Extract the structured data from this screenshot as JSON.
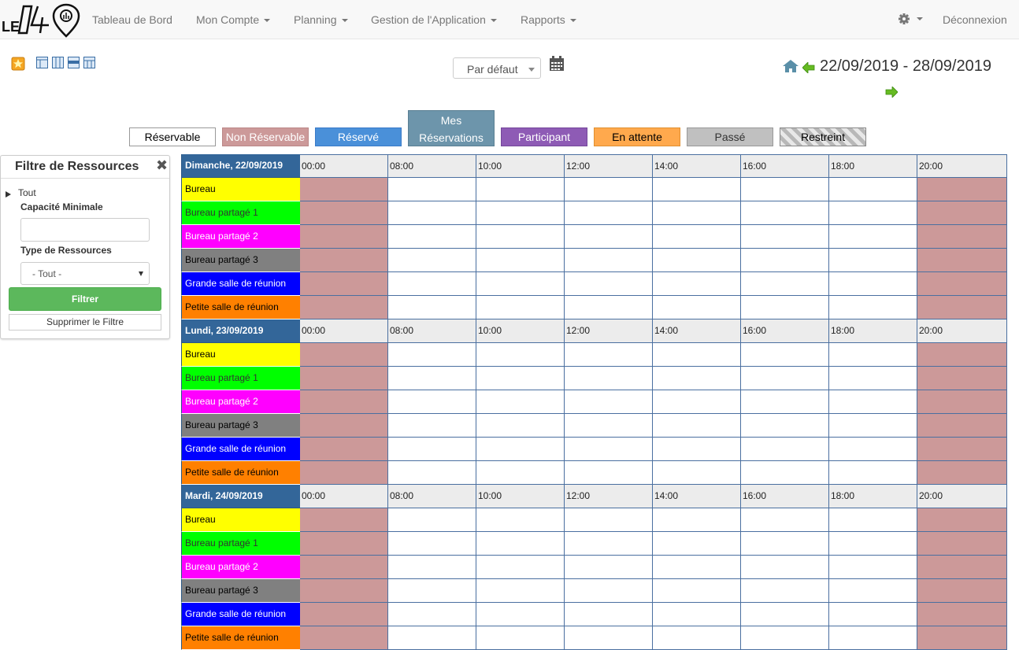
{
  "nav": {
    "logo_text": "LE 140",
    "items": [
      {
        "label": "Tableau de Bord",
        "dropdown": false
      },
      {
        "label": "Mon Compte",
        "dropdown": true
      },
      {
        "label": "Planning",
        "dropdown": true
      },
      {
        "label": "Gestion de l'Application",
        "dropdown": true
      },
      {
        "label": "Rapports",
        "dropdown": true
      }
    ],
    "settings_icon": "gear-icon",
    "logout": "Déconnexion"
  },
  "toolbar": {
    "layout_select_value": "Par défaut",
    "date_range": "22/09/2019 - 28/09/2019"
  },
  "legend": [
    {
      "label": "Réservable",
      "bg": "#ffffff",
      "fg": "#000000"
    },
    {
      "label": "Non Réservable",
      "bg": "#cc9999",
      "fg": "#ffffff"
    },
    {
      "label": "Réservé",
      "bg": "#4a90d9",
      "fg": "#ffffff"
    },
    {
      "label": "Mes Réservations",
      "bg": "#6d95ab",
      "fg": "#ffffff"
    },
    {
      "label": "Participant",
      "bg": "#8e5bb5",
      "fg": "#ffffff"
    },
    {
      "label": "En attente",
      "bg": "#ffa94d",
      "fg": "#000000"
    },
    {
      "label": "Passé",
      "bg": "#c0c0c0",
      "fg": "#333333"
    },
    {
      "label": "Restreint",
      "bg": "#d0d0d0",
      "fg": "#000000"
    }
  ],
  "filter": {
    "title": "Filtre de Ressources",
    "tree_root": "Tout",
    "min_capacity_label": "Capacité Minimale",
    "min_capacity_value": "",
    "resource_type_label": "Type de Ressources",
    "resource_type_value": "- Tout -",
    "filter_button": "Filtrer",
    "clear_button": "Supprimer le Filtre"
  },
  "schedule": {
    "times": [
      "00:00",
      "08:00",
      "10:00",
      "12:00",
      "14:00",
      "16:00",
      "18:00",
      "20:00"
    ],
    "resources": [
      {
        "name": "Bureau",
        "bg": "#ffff00",
        "fg": "#000000"
      },
      {
        "name": "Bureau partagé 1",
        "bg": "#00ff00",
        "fg": "#333333"
      },
      {
        "name": "Bureau partagé 2",
        "bg": "#ff00ff",
        "fg": "#ffffff"
      },
      {
        "name": "Bureau partagé 3",
        "bg": "#808080",
        "fg": "#000000"
      },
      {
        "name": "Grande salle de réunion",
        "bg": "#0000ff",
        "fg": "#ffffff"
      },
      {
        "name": "Petite salle de réunion",
        "bg": "#ff8000",
        "fg": "#000000"
      }
    ],
    "days": [
      "Dimanche, 22/09/2019",
      "Lundi, 23/09/2019",
      "Mardi, 24/09/2019"
    ],
    "unreservable_color": "#cc9999"
  }
}
